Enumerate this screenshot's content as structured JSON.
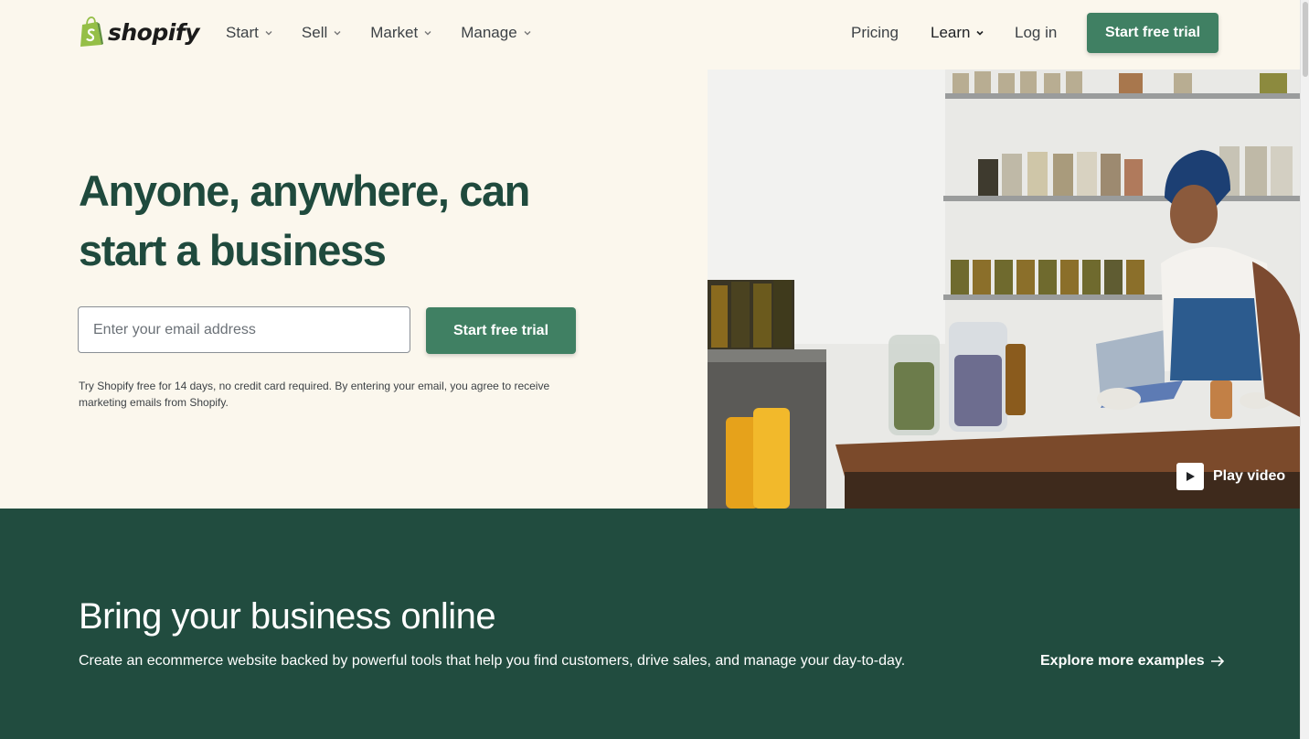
{
  "brand": {
    "name": "shopify",
    "color": "#95bf47"
  },
  "nav": {
    "left": [
      {
        "label": "Start"
      },
      {
        "label": "Sell"
      },
      {
        "label": "Market"
      },
      {
        "label": "Manage"
      }
    ],
    "pricing": "Pricing",
    "learn": "Learn",
    "login": "Log in",
    "cta": "Start free trial"
  },
  "hero": {
    "title": "Anyone, anywhere, can start a business",
    "email_placeholder": "Enter your email address",
    "email_value": "",
    "cta": "Start free trial",
    "disclaimer": "Try Shopify free for 14 days, no credit card required. By entering your email, you agree to receive marketing emails from Shopify.",
    "play_video": "Play video"
  },
  "section": {
    "title": "Bring your business online",
    "subtitle": "Create an ecommerce website backed by powerful tools that help you find customers, drive sales, and manage your day-to-day.",
    "link": "Explore more examples",
    "background": "#214c3f"
  },
  "colors": {
    "accent": "#408063",
    "heading": "#1f4a3d",
    "page_bg": "#fbf7ed"
  }
}
